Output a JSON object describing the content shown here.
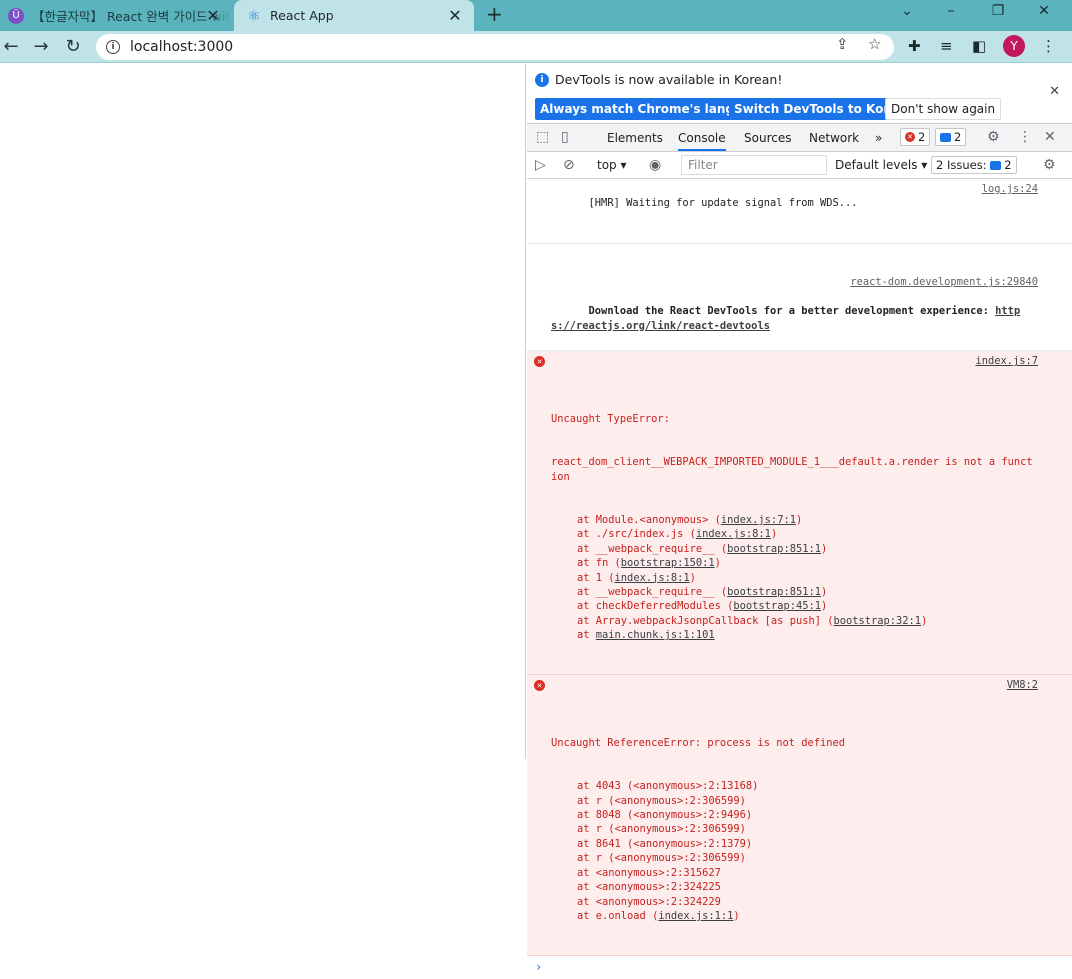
{
  "browser": {
    "tabs": [
      {
        "title": "【한글자막】 React 완벽 가이드 with",
        "favicon": "udemy-icon"
      },
      {
        "title": "React App",
        "favicon": "react-icon"
      }
    ],
    "new_tab": "+",
    "url": "localhost:3000",
    "avatar_letter": "Y"
  },
  "devtools": {
    "infobar": {
      "message": "DevTools is now available in Korean!",
      "btn_match": "Always match Chrome's language",
      "btn_switch": "Switch DevTools to Korean",
      "btn_dont": "Don't show again"
    },
    "tabs": [
      "Elements",
      "Console",
      "Sources",
      "Network"
    ],
    "error_count": "2",
    "message_count": "2",
    "context": "top",
    "filter_placeholder": "Filter",
    "levels": "Default levels",
    "issues_label": "2 Issues:",
    "issues_count": "2"
  },
  "console": {
    "hmr": {
      "text": "[HMR] Waiting for update signal from WDS...",
      "src": "log.js:24"
    },
    "react_devtools": {
      "src": "react-dom.development.js:29840",
      "text": "Download the React DevTools for a better development experience: ",
      "link": "https://reactjs.org/link/react-devtools"
    },
    "error1": {
      "src": "index.js:7",
      "head": "Uncaught TypeError:",
      "body": "react_dom_client__WEBPACK_IMPORTED_MODULE_1___default.a.render is not a function",
      "stack": [
        {
          "pre": "at Module.<anonymous> (",
          "link": "index.js:7:1",
          "post": ")"
        },
        {
          "pre": "at ./src/index.js (",
          "link": "index.js:8:1",
          "post": ")"
        },
        {
          "pre": "at __webpack_require__ (",
          "link": "bootstrap:851:1",
          "post": ")"
        },
        {
          "pre": "at fn (",
          "link": "bootstrap:150:1",
          "post": ")"
        },
        {
          "pre": "at 1 (",
          "link": "index.js:8:1",
          "post": ")"
        },
        {
          "pre": "at __webpack_require__ (",
          "link": "bootstrap:851:1",
          "post": ")"
        },
        {
          "pre": "at checkDeferredModules (",
          "link": "bootstrap:45:1",
          "post": ")"
        },
        {
          "pre": "at Array.webpackJsonpCallback [as push] (",
          "link": "bootstrap:32:1",
          "post": ")"
        },
        {
          "pre": "at ",
          "link": "main.chunk.js:1:101",
          "post": ""
        }
      ]
    },
    "error2": {
      "src": "VM8:2",
      "head": "Uncaught ReferenceError: process is not defined",
      "stack": [
        {
          "pre": "at 4043 (<anonymous>:2:13168)",
          "link": "",
          "post": ""
        },
        {
          "pre": "at r (<anonymous>:2:306599)",
          "link": "",
          "post": ""
        },
        {
          "pre": "at 8048 (<anonymous>:2:9496)",
          "link": "",
          "post": ""
        },
        {
          "pre": "at r (<anonymous>:2:306599)",
          "link": "",
          "post": ""
        },
        {
          "pre": "at 8641 (<anonymous>:2:1379)",
          "link": "",
          "post": ""
        },
        {
          "pre": "at r (<anonymous>:2:306599)",
          "link": "",
          "post": ""
        },
        {
          "pre": "at <anonymous>:2:315627",
          "link": "",
          "post": ""
        },
        {
          "pre": "at <anonymous>:2:324225",
          "link": "",
          "post": ""
        },
        {
          "pre": "at <anonymous>:2:324229",
          "link": "",
          "post": ""
        },
        {
          "pre": "at e.onload (",
          "link": "index.js:1:1",
          "post": ")"
        }
      ]
    },
    "prompt": "›"
  }
}
